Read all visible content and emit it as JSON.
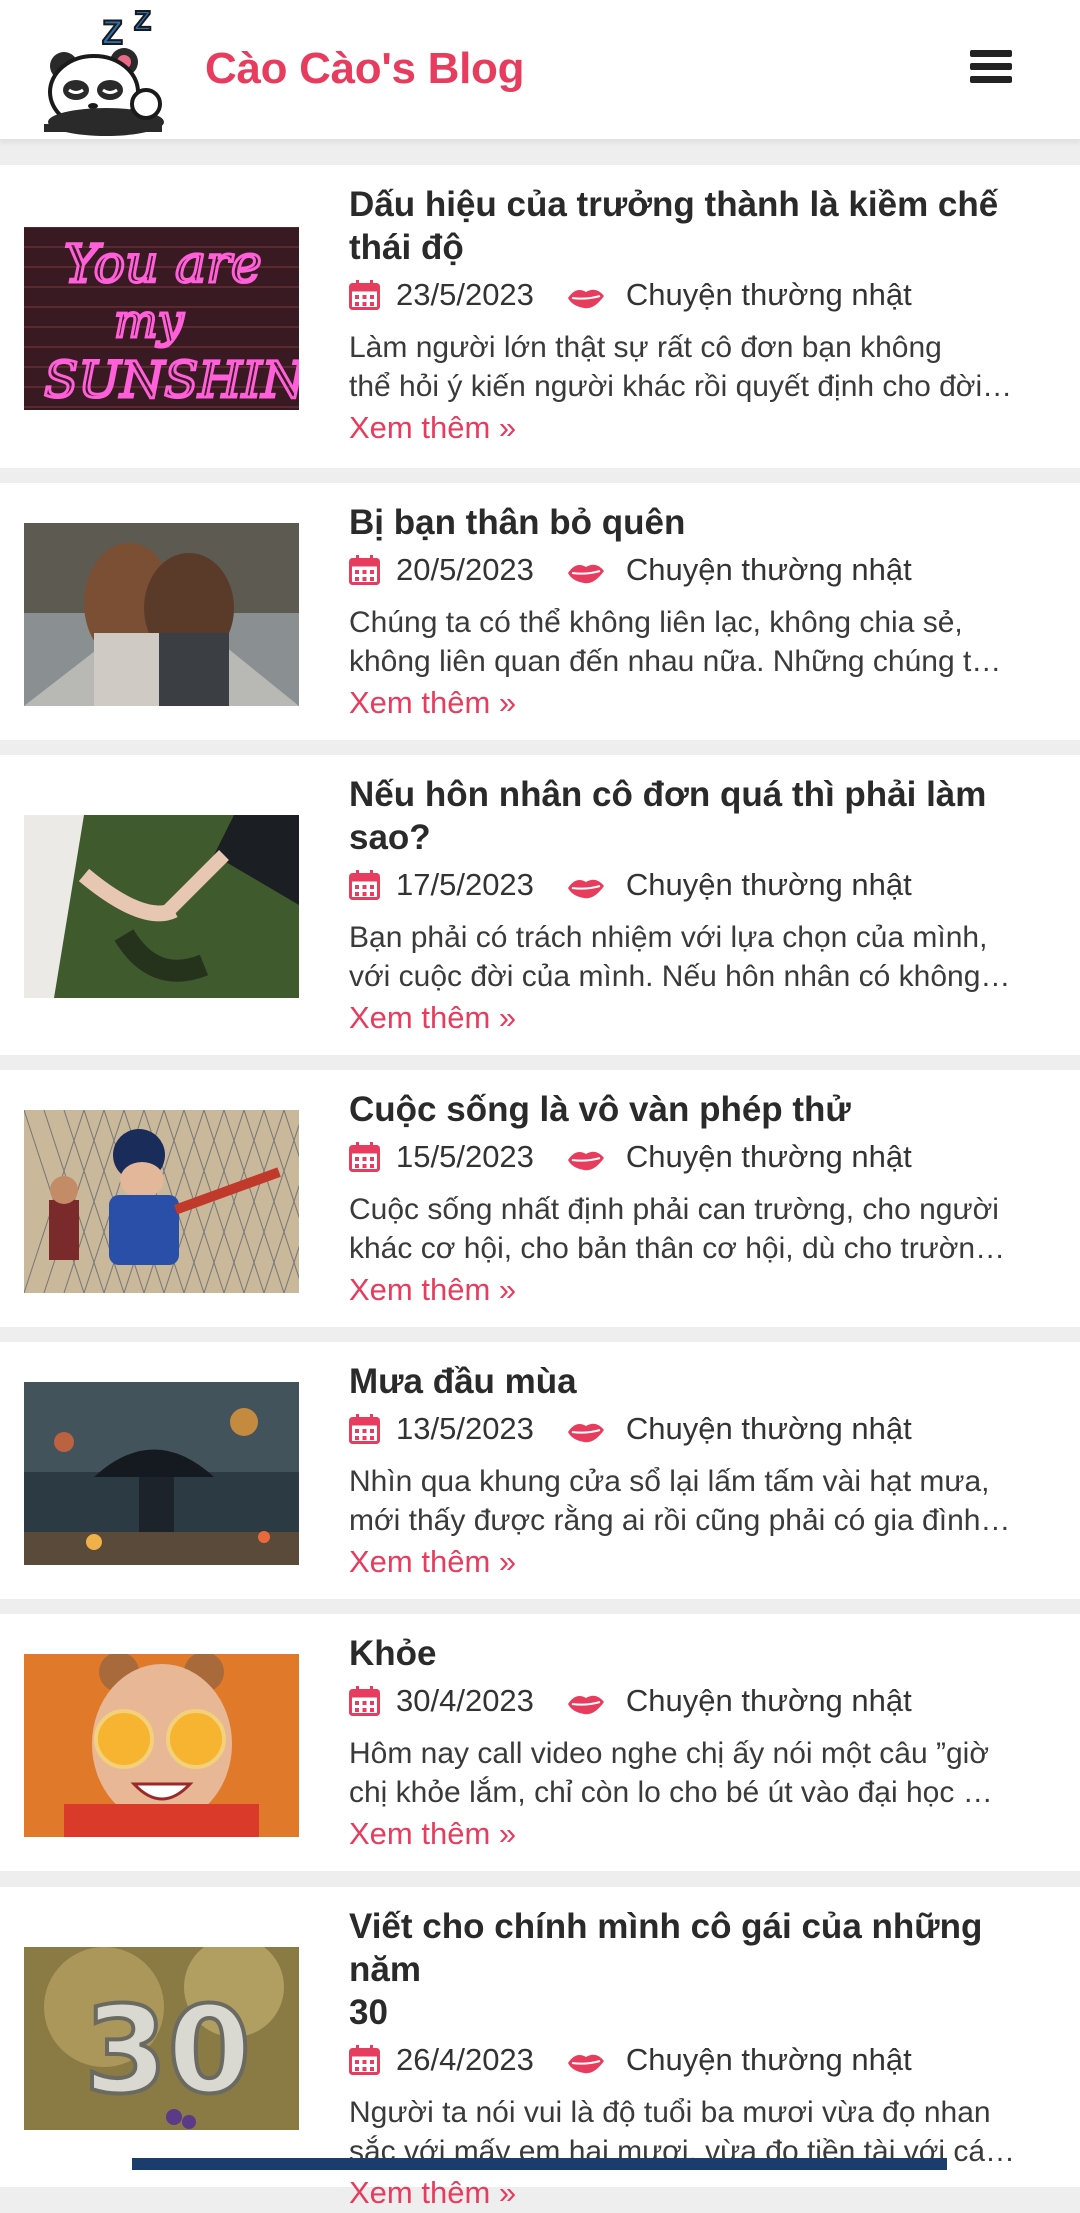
{
  "header": {
    "site_title": "Cào Cào's Blog",
    "logo_icon": "panda-sleeping-logo",
    "menu_icon": "hamburger-menu-icon"
  },
  "theme": {
    "accent": "#e83c5f",
    "text": "#2a2a2a",
    "background": "#eeeeee"
  },
  "posts": [
    {
      "title_lines": [
        "Dấu hiệu của trưởng thành là kiềm chế",
        "thái độ"
      ],
      "date": "23/5/2023",
      "category": "Chuyện thường nhật",
      "excerpt_lines": [
        "Làm người lớn thật sự rất cô đơn bạn không",
        "thể hỏi ý kiến người khác rồi quyết định cho đời…"
      ],
      "read_more": "Xem thêm »",
      "image_icon": "neon-sign-image"
    },
    {
      "title_lines": [
        "Bị bạn thân bỏ quên"
      ],
      "date": "20/5/2023",
      "category": "Chuyện thường nhật",
      "excerpt_lines": [
        "Chúng ta có thể không liên lạc, không chia sẻ,",
        "không liên quan đến nhau nữa. Những chúng t…"
      ],
      "read_more": "Xem thêm »",
      "image_icon": "friends-hugging-image"
    },
    {
      "title_lines": [
        "Nếu hôn nhân cô đơn quá thì phải làm",
        "sao?"
      ],
      "date": "17/5/2023",
      "category": "Chuyện thường nhật",
      "excerpt_lines": [
        "Bạn phải có trách nhiệm với lựa chọn của mình,",
        "với cuộc đời của mình. Nếu hôn nhân có không…"
      ],
      "read_more": "Xem thêm »",
      "image_icon": "holding-hands-image"
    },
    {
      "title_lines": [
        "Cuộc sống là vô vàn phép thử"
      ],
      "date": "15/5/2023",
      "category": "Chuyện thường nhật",
      "excerpt_lines": [
        "Cuộc sống nhất định phải can trường, cho người",
        "khác cơ hội, cho bản thân cơ hội, dù cho trườn…"
      ],
      "read_more": "Xem thêm »",
      "image_icon": "baseball-kid-image"
    },
    {
      "title_lines": [
        "Mưa đầu mùa"
      ],
      "date": "13/5/2023",
      "category": "Chuyện thường nhật",
      "excerpt_lines": [
        "Nhìn qua khung cửa sổ lại lấm tấm vài hạt mưa,",
        "mới thấy được rằng ai rồi cũng phải có gia đình…"
      ],
      "read_more": "Xem thêm »",
      "image_icon": "rainy-street-image"
    },
    {
      "title_lines": [
        "Khỏe"
      ],
      "date": "30/4/2023",
      "category": "Chuyện thường nhật",
      "excerpt_lines": [
        "Hôm nay call video nghe chị ấy nói một câu ”giờ",
        "chị khỏe lắm, chỉ còn lo cho bé út vào đại học …"
      ],
      "read_more": "Xem thêm »",
      "image_icon": "orange-girl-image"
    },
    {
      "title_lines": [
        "Viết cho chính mình cô gái của những năm",
        "30"
      ],
      "date": "26/4/2023",
      "category": "Chuyện thường nhật",
      "excerpt_lines": [
        "Người ta nói vui là độ tuổi ba mươi vừa đọ nhan",
        "sắc với mấy em hai mươi, vừa đọ tiền tài với cá…"
      ],
      "read_more": "Xem thêm »",
      "image_icon": "balloon-30-image"
    }
  ]
}
